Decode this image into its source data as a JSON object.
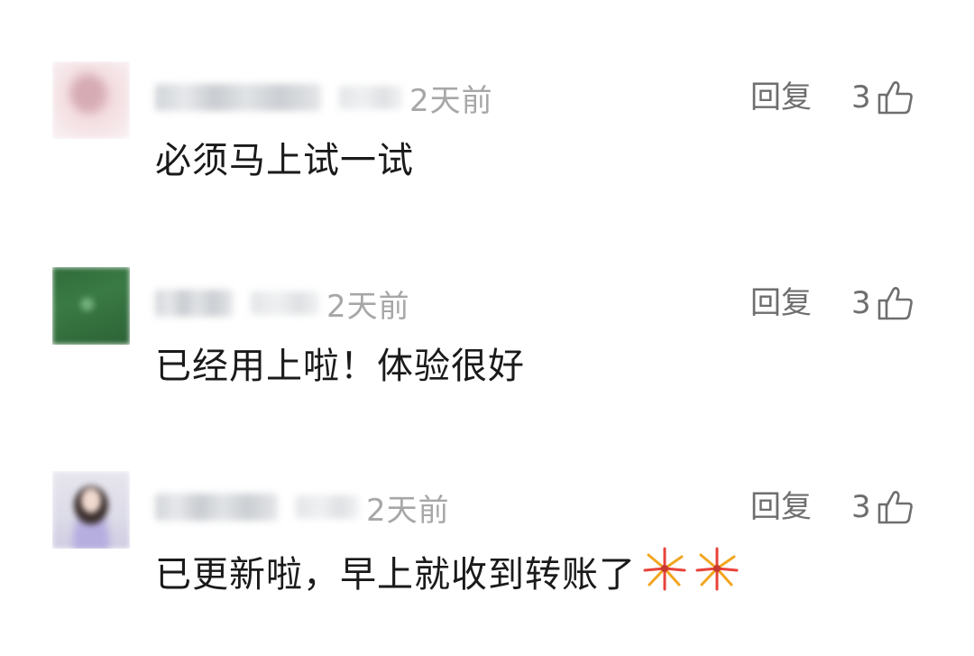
{
  "comments": [
    {
      "time": "2天前",
      "reply_label": "回复",
      "like_count": "3",
      "text": "必须马上试一试",
      "avatar_icon": "avatar-pink",
      "emoji": []
    },
    {
      "time": "2天前",
      "reply_label": "回复",
      "like_count": "3",
      "text": "已经用上啦！体验很好",
      "avatar_icon": "avatar-green",
      "emoji": []
    },
    {
      "time": "2天前",
      "reply_label": "回复",
      "like_count": "3",
      "text": "已更新啦，早上就收到转账了",
      "avatar_icon": "avatar-portrait",
      "emoji": [
        "fireworks-icon",
        "fireworks-icon"
      ]
    }
  ],
  "icons": {
    "like": "thumbs-up-icon"
  },
  "colors": {
    "text": "#1a1a1a",
    "meta": "#a7a7a7",
    "action": "#6e6e6e",
    "background": "#ffffff"
  }
}
